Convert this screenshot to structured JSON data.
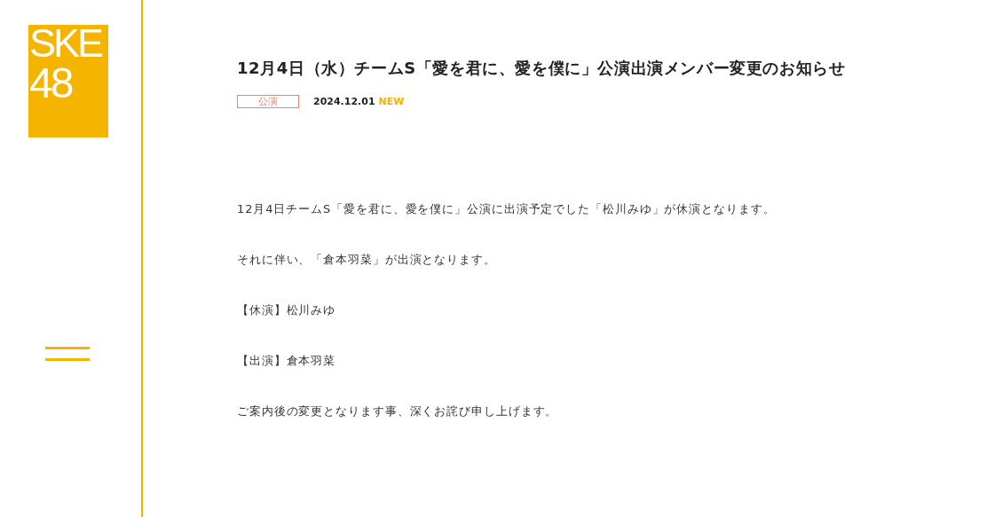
{
  "logo": {
    "lines": [
      "SKE",
      "48"
    ]
  },
  "article": {
    "title": "12月4日（水）チームS「愛を君に、愛を僕に」公演出演メンバー変更のお知らせ",
    "category": "公演",
    "date": "2024.12.01",
    "new_label": "NEW",
    "paragraphs": [
      "12月4日チームS「愛を君に、愛を僕に」公演に出演予定でした「松川みゆ」が休演となります。",
      "それに伴い、「倉本羽菜」が出演となります。",
      "【休演】松川みゆ",
      "【出演】倉本羽菜",
      "ご案内後の変更となります事、深くお詫び申し上げます。"
    ]
  }
}
